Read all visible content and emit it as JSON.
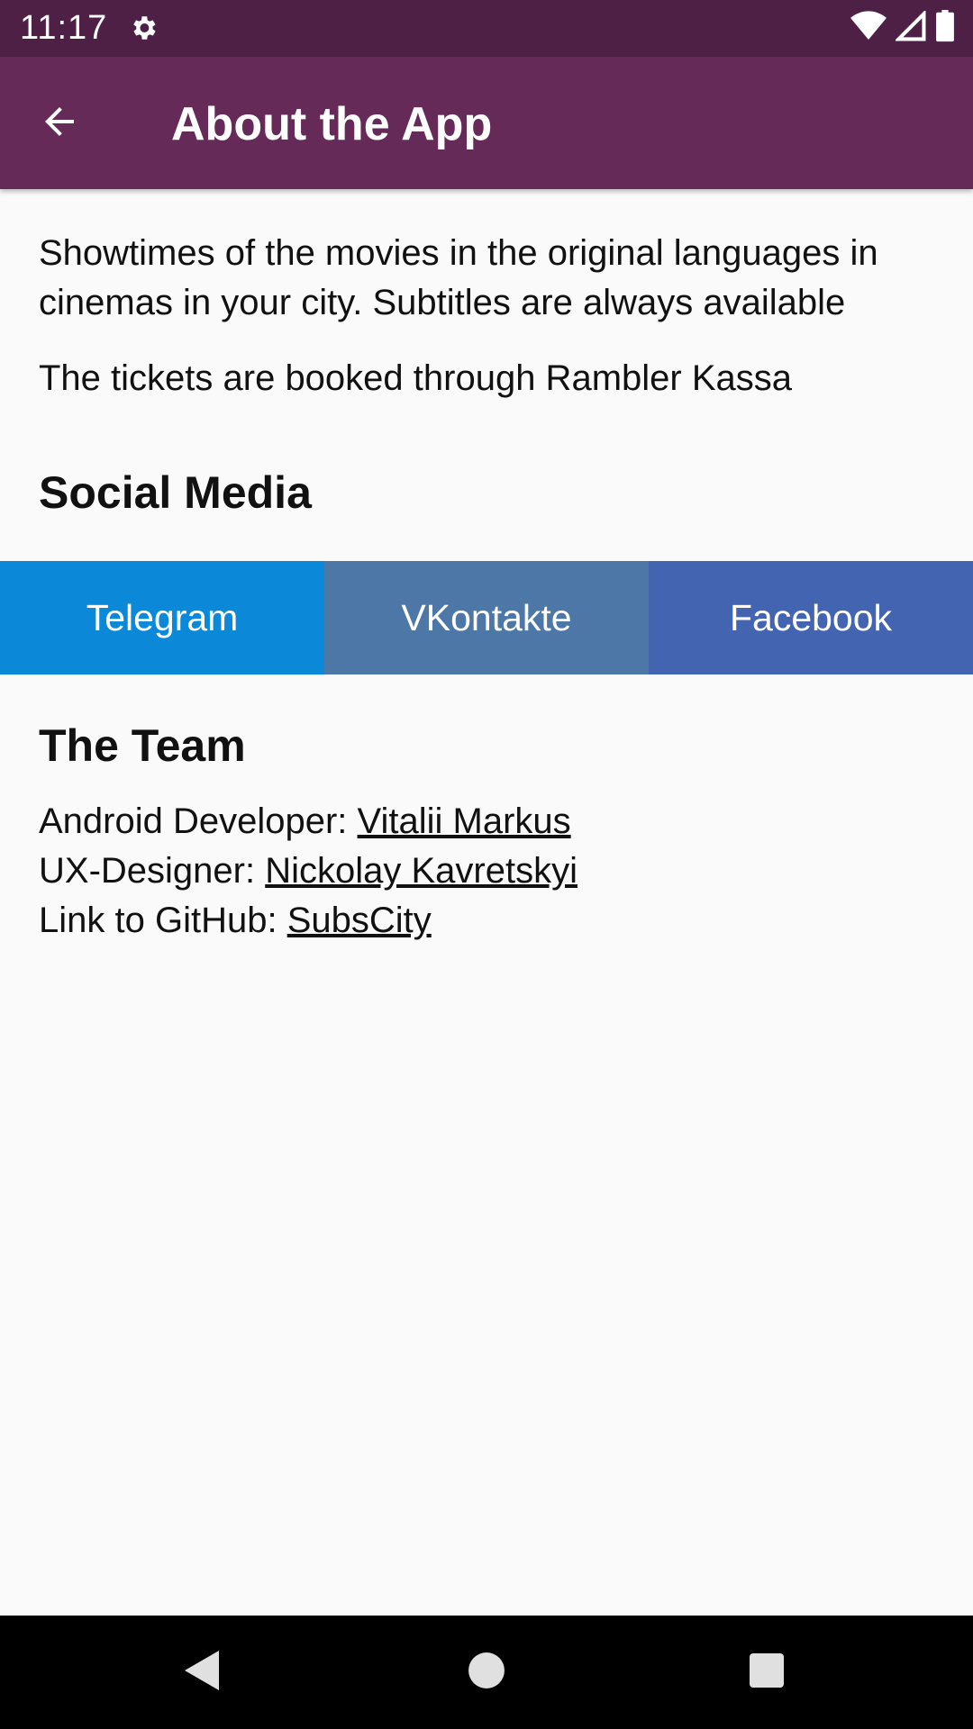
{
  "status_bar": {
    "time": "11:17",
    "icons": [
      "gear-icon",
      "wifi-icon",
      "signal-icon",
      "battery-icon"
    ]
  },
  "app_bar": {
    "title": "About the App",
    "back_icon": "arrow-back-icon"
  },
  "about": {
    "description": "Showtimes of the movies in the original languages in cinemas in your city. Subtitles are always available",
    "booking": "The tickets are booked through Rambler Kassa"
  },
  "social": {
    "heading": "Social Media",
    "buttons": [
      {
        "label": "Telegram",
        "color": "#0B88D7"
      },
      {
        "label": "VKontakte",
        "color": "#4C77A7"
      },
      {
        "label": "Facebook",
        "color": "#4364B0"
      }
    ]
  },
  "team": {
    "heading": "The Team",
    "members": [
      {
        "role": "Android Developer: ",
        "name": "Vitalii Markus"
      },
      {
        "role": "UX-Designer: ",
        "name": "Nickolay Kavretskyi"
      },
      {
        "role": "Link to GitHub: ",
        "name": "SubsCity"
      }
    ]
  },
  "nav_bar": {
    "icons": [
      "back-triangle-icon",
      "home-circle-icon",
      "recents-square-icon"
    ]
  },
  "colors": {
    "status_bar": "#4F2045",
    "app_bar": "#652A57",
    "background": "#FAFAFA"
  }
}
